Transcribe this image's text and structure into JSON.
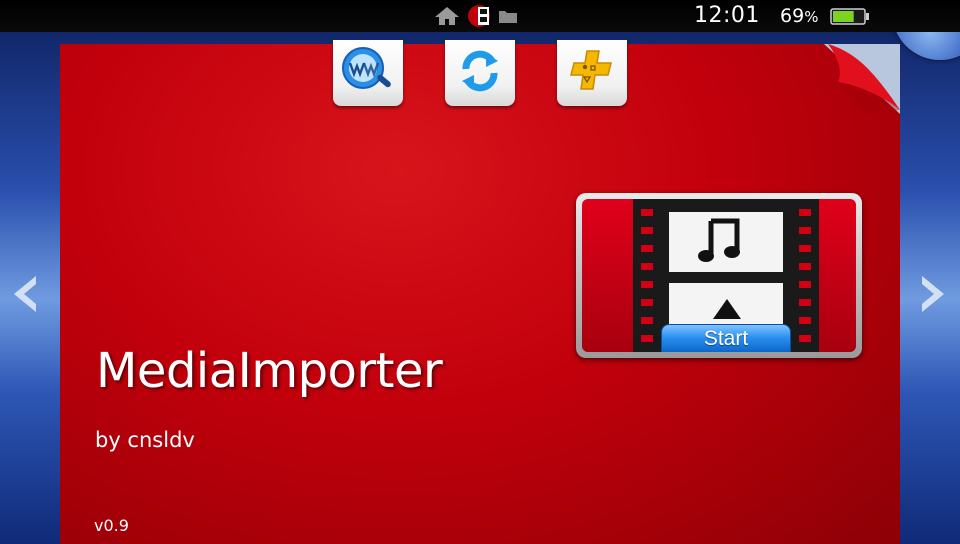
{
  "status_bar": {
    "time": "12:01",
    "battery_percent": "69",
    "battery_unit": "%",
    "battery_level": 0.69,
    "icons": [
      "home-icon",
      "app-icon",
      "folder-icon"
    ]
  },
  "top_buttons": [
    {
      "name": "www-search-icon"
    },
    {
      "name": "refresh-icon"
    },
    {
      "name": "psplus-icon"
    }
  ],
  "app": {
    "title": "MediaImporter",
    "author": "by cnsldv",
    "version": "v0.9"
  },
  "launch_tile": {
    "start_label": "Start"
  },
  "navigation": {
    "left_arrow": "left-arrow-icon",
    "right_arrow": "right-arrow-icon"
  },
  "colors": {
    "card": "#c2000c",
    "start_button": "#2a8ff0",
    "battery": "#7ed321"
  }
}
